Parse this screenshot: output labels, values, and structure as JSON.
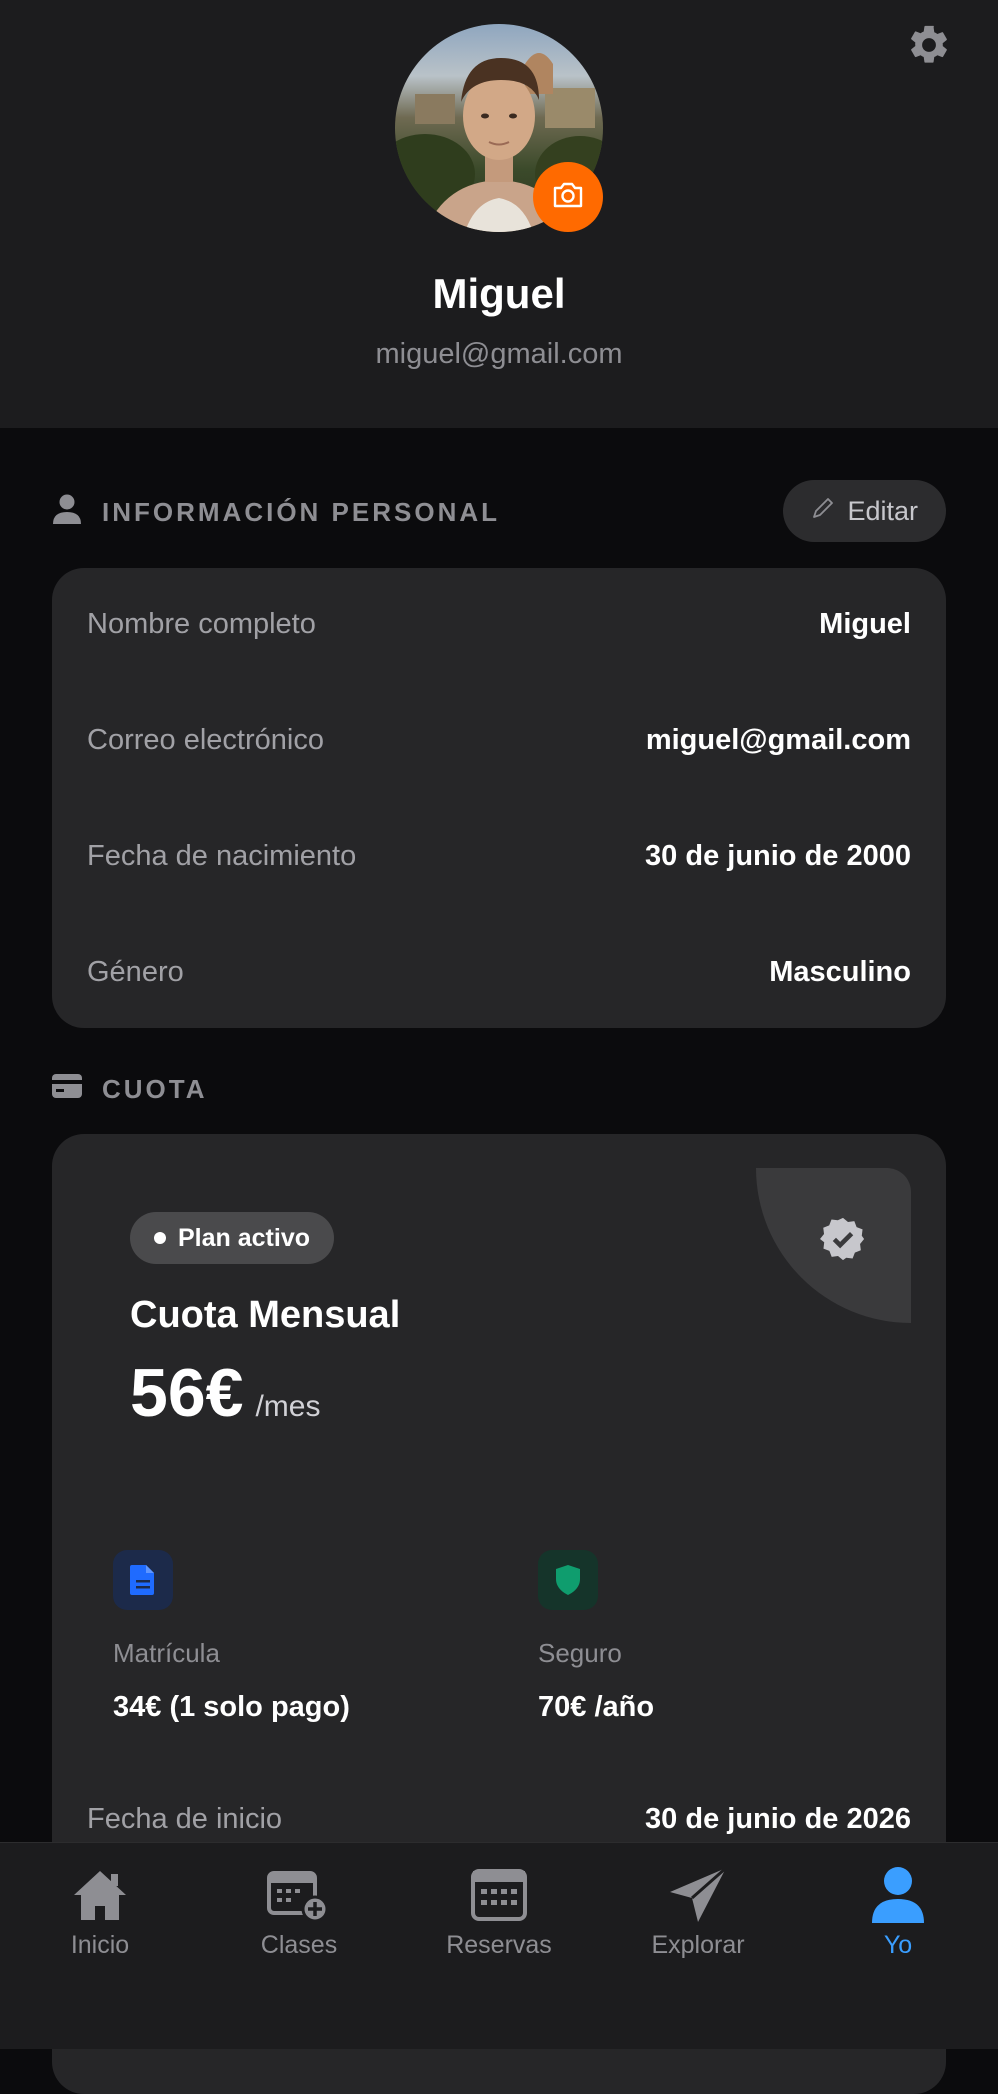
{
  "header": {
    "name": "Miguel",
    "email": "miguel@gmail.com",
    "settings_icon": "gear-icon",
    "camera_icon": "camera-icon"
  },
  "personal_info": {
    "title": "INFORMACIÓN PERSONAL",
    "edit_label": "Editar",
    "rows": [
      {
        "label": "Nombre completo",
        "value": "Miguel"
      },
      {
        "label": "Correo electrónico",
        "value": "miguel@gmail.com"
      },
      {
        "label": "Fecha de nacimiento",
        "value": "30 de junio de 2000"
      },
      {
        "label": "Género",
        "value": "Masculino"
      }
    ]
  },
  "cuota": {
    "title": "CUOTA",
    "status": "Plan activo",
    "plan_name": "Cuota Mensual",
    "price": "56€",
    "period": "/mes",
    "extras": [
      {
        "label": "Matrícula",
        "value": "34€ (1 solo pago)",
        "icon": "document-icon",
        "color": "#1f6bff"
      },
      {
        "label": "Seguro",
        "value": "70€ /año",
        "icon": "shield-icon",
        "color": "#0f9d6e"
      }
    ],
    "start_label": "Fecha de inicio",
    "start_value": "30 de junio de 2026"
  },
  "tabs": [
    {
      "label": "Inicio",
      "icon": "home-icon"
    },
    {
      "label": "Clases",
      "icon": "calendar-add-icon"
    },
    {
      "label": "Reservas",
      "icon": "calendar-icon"
    },
    {
      "label": "Explorar",
      "icon": "paper-plane-icon"
    },
    {
      "label": "Yo",
      "icon": "person-icon",
      "active": true
    }
  ],
  "colors": {
    "accent": "#ff6a00",
    "active_tab": "#3a9eff",
    "background": "#0b0b0d",
    "card": "#262628"
  }
}
